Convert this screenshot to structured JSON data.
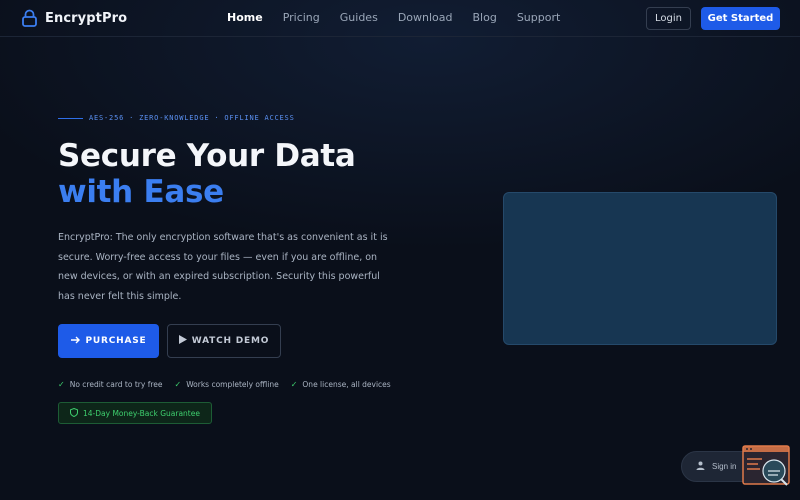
{
  "brand": {
    "name": "EncryptPro",
    "icon": "lock-icon"
  },
  "nav": {
    "links": [
      {
        "label": "Home",
        "active": true
      },
      {
        "label": "Pricing",
        "active": false
      },
      {
        "label": "Guides",
        "active": false
      },
      {
        "label": "Download",
        "active": false
      },
      {
        "label": "Blog",
        "active": false
      },
      {
        "label": "Support",
        "active": false
      }
    ],
    "login_label": "Login",
    "get_started_label": "Get Started"
  },
  "hero": {
    "tagline": "AES-256 · ZERO-KNOWLEDGE · OFFLINE ACCESS",
    "title_line1": "Secure Your Data",
    "title_line2": "with Ease",
    "description": "EncryptPro: The only encryption software that's as convenient as it is secure. Worry-free access to your files — even if you are offline, on new devices, or with an expired subscription. Security this powerful has never felt this simple.",
    "purchase_label": "PURCHASE",
    "purchase_icon": "arrow-right-icon",
    "demo_label": "WATCH DEMO",
    "demo_icon": "play-icon",
    "features": [
      {
        "label": "No credit card to try free",
        "icon": "check-icon"
      },
      {
        "label": "Works completely offline",
        "icon": "check-icon"
      },
      {
        "label": "One license, all devices",
        "icon": "check-icon"
      }
    ],
    "guarantee": "14-Day Money-Back Guarantee",
    "guarantee_icon": "shield-icon"
  },
  "signin": {
    "label": "Sign in",
    "icon": "user-icon"
  },
  "colors": {
    "background": "#0a0f1a",
    "accent": "#1e5be8",
    "accent_text": "#3b7ef0",
    "success": "#3ecf6e",
    "panel": "#173652"
  }
}
